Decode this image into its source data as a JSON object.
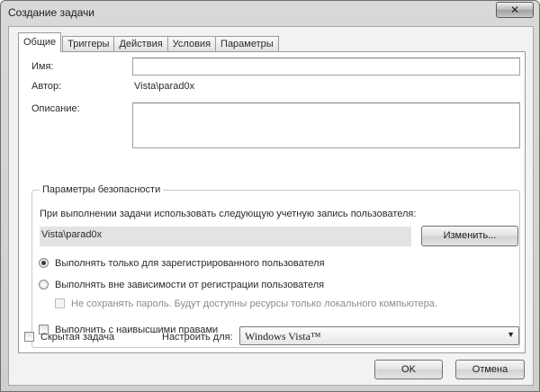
{
  "window": {
    "title": "Создание задачи",
    "close_glyph": "✕"
  },
  "tabs": [
    {
      "label": "Общие",
      "active": true
    },
    {
      "label": "Триггеры",
      "active": false
    },
    {
      "label": "Действия",
      "active": false
    },
    {
      "label": "Условия",
      "active": false
    },
    {
      "label": "Параметры",
      "active": false
    }
  ],
  "general": {
    "name_label": "Имя:",
    "name_value": "",
    "author_label": "Автор:",
    "author_value": "Vista\\parad0x",
    "description_label": "Описание:",
    "description_value": ""
  },
  "security": {
    "group_title": "Параметры безопасности",
    "account_prompt": "При выполнении задачи использовать следующую учетную запись пользователя:",
    "account_value": "Vista\\parad0x",
    "change_button": "Изменить...",
    "radio_logged_on": {
      "label": "Выполнять только для зарегистрированного пользователя",
      "checked": true
    },
    "radio_any": {
      "label": "Выполнять вне зависимости от регистрации пользователя",
      "checked": false
    },
    "no_store_password": {
      "label": "Не сохранять пароль. Будут доступны ресурсы только локального компьютера.",
      "checked": false,
      "enabled": false
    },
    "highest_privileges": {
      "label": "Выполнить с наивысшими правами",
      "checked": false
    }
  },
  "footer": {
    "hidden_task": {
      "label": "Скрытая задача",
      "checked": false
    },
    "configure_for_label": "Настроить для:",
    "configure_for_value": "Windows Vista™",
    "ok_button": "OK",
    "cancel_button": "Отмена"
  }
}
